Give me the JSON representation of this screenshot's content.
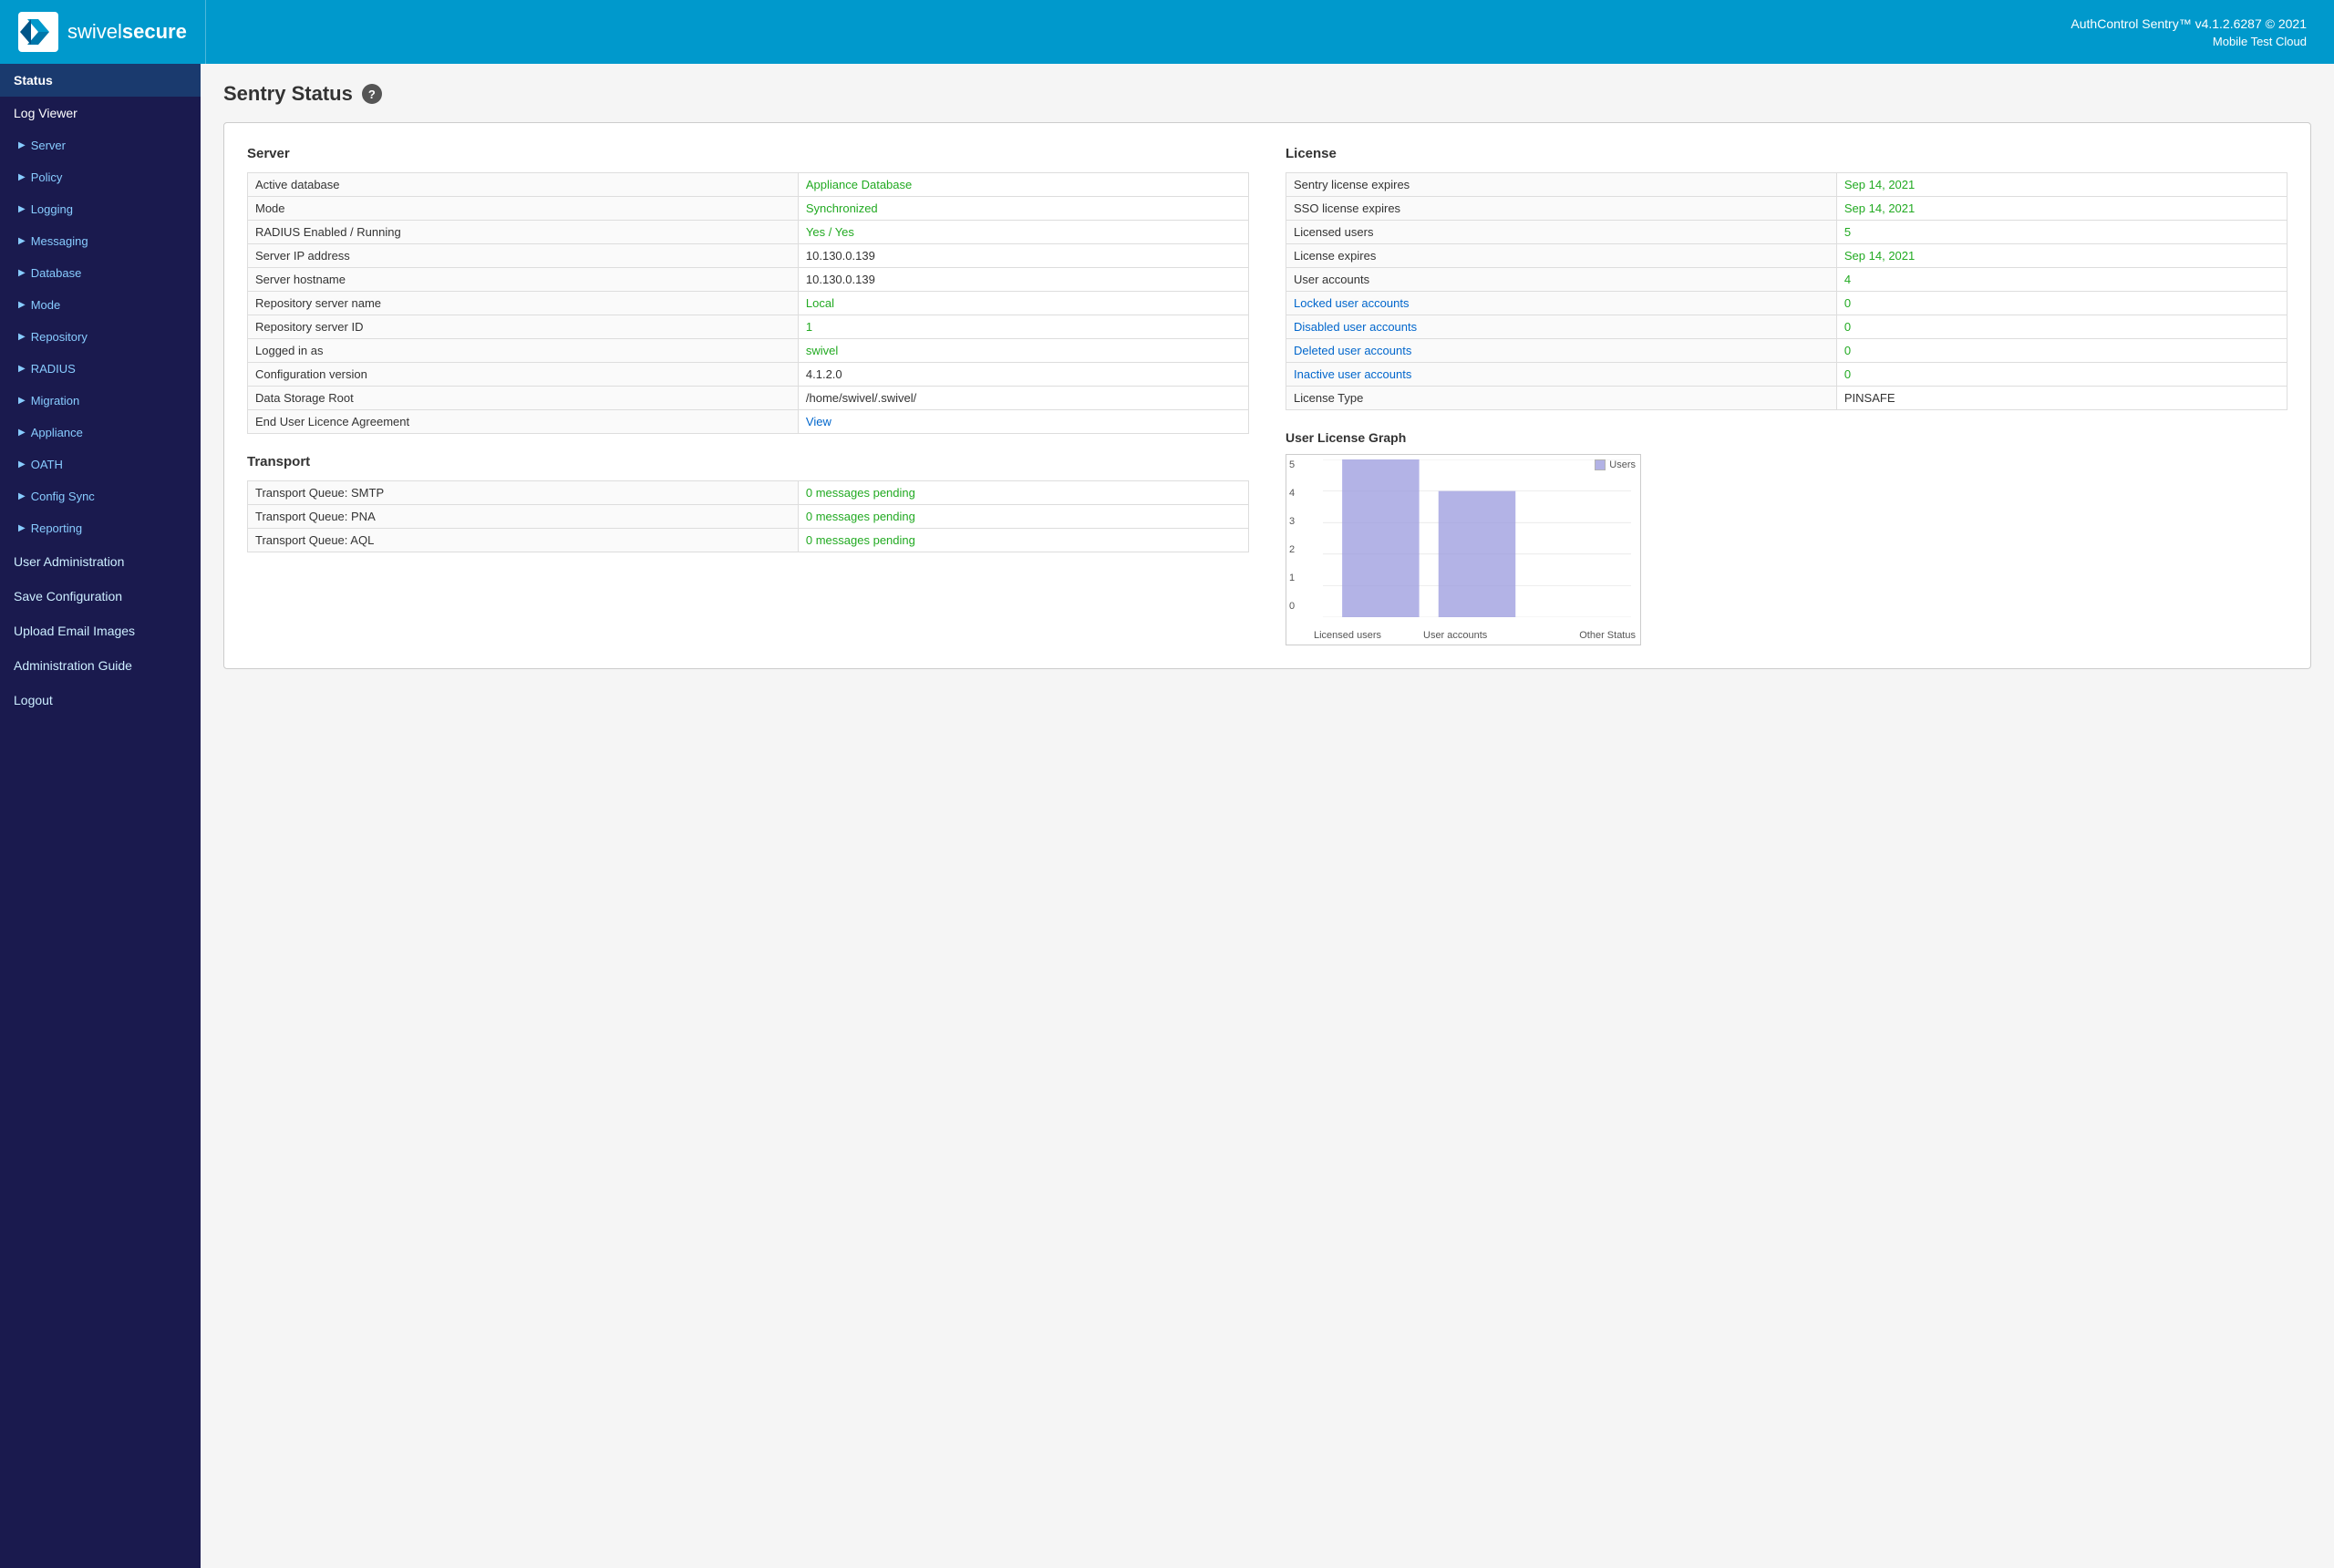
{
  "header": {
    "app_title": "AuthControl Sentry™ v4.1.2.6287 © 2021",
    "app_subtitle": "Mobile Test Cloud",
    "logo_text_normal": "swivel",
    "logo_text_bold": "secure"
  },
  "sidebar": {
    "items": [
      {
        "id": "status",
        "label": "Status",
        "level": "active",
        "chevron": false
      },
      {
        "id": "log-viewer",
        "label": "Log Viewer",
        "level": "top",
        "chevron": false
      },
      {
        "id": "server",
        "label": "Server",
        "level": "sub",
        "chevron": true
      },
      {
        "id": "policy",
        "label": "Policy",
        "level": "sub",
        "chevron": true
      },
      {
        "id": "logging",
        "label": "Logging",
        "level": "sub",
        "chevron": true
      },
      {
        "id": "messaging",
        "label": "Messaging",
        "level": "sub",
        "chevron": true
      },
      {
        "id": "database",
        "label": "Database",
        "level": "sub",
        "chevron": true
      },
      {
        "id": "mode",
        "label": "Mode",
        "level": "sub",
        "chevron": true
      },
      {
        "id": "repository",
        "label": "Repository",
        "level": "sub",
        "chevron": true
      },
      {
        "id": "radius",
        "label": "RADIUS",
        "level": "sub",
        "chevron": true
      },
      {
        "id": "migration",
        "label": "Migration",
        "level": "sub",
        "chevron": true
      },
      {
        "id": "appliance",
        "label": "Appliance",
        "level": "sub",
        "chevron": true
      },
      {
        "id": "oath",
        "label": "OATH",
        "level": "sub",
        "chevron": true
      },
      {
        "id": "config-sync",
        "label": "Config Sync",
        "level": "sub",
        "chevron": true
      },
      {
        "id": "reporting",
        "label": "Reporting",
        "level": "sub",
        "chevron": true
      },
      {
        "id": "user-admin",
        "label": "User Administration",
        "level": "plain",
        "chevron": false
      },
      {
        "id": "save-config",
        "label": "Save Configuration",
        "level": "plain",
        "chevron": false
      },
      {
        "id": "upload-email",
        "label": "Upload Email Images",
        "level": "plain",
        "chevron": false
      },
      {
        "id": "admin-guide",
        "label": "Administration Guide",
        "level": "plain",
        "chevron": false
      },
      {
        "id": "logout",
        "label": "Logout",
        "level": "plain",
        "chevron": false
      }
    ]
  },
  "page": {
    "title": "Sentry Status",
    "help_symbol": "?"
  },
  "server_section": {
    "title": "Server",
    "rows": [
      {
        "label": "Active database",
        "value": "Appliance Database",
        "style": "green"
      },
      {
        "label": "Mode",
        "value": "Synchronized",
        "style": "green"
      },
      {
        "label": "RADIUS Enabled / Running",
        "value": "Yes / Yes",
        "style": "green"
      },
      {
        "label": "Server IP address",
        "value": "10.130.0.139",
        "style": "normal"
      },
      {
        "label": "Server hostname",
        "value": "10.130.0.139",
        "style": "normal"
      },
      {
        "label": "Repository server name",
        "value": "Local",
        "style": "green"
      },
      {
        "label": "Repository server ID",
        "value": "1",
        "style": "green"
      },
      {
        "label": "Logged in as",
        "value": "swivel",
        "style": "green"
      },
      {
        "label": "Configuration version",
        "value": "4.1.2.0",
        "style": "normal"
      },
      {
        "label": "Data Storage Root",
        "value": "/home/swivel/.swivel/",
        "style": "normal"
      },
      {
        "label": "End User Licence Agreement",
        "value": "View",
        "style": "link"
      }
    ]
  },
  "transport_section": {
    "title": "Transport",
    "rows": [
      {
        "label": "Transport Queue: SMTP",
        "value": "0 messages pending",
        "style": "green"
      },
      {
        "label": "Transport Queue: PNA",
        "value": "0 messages pending",
        "style": "green"
      },
      {
        "label": "Transport Queue: AQL",
        "value": "0 messages pending",
        "style": "green"
      }
    ]
  },
  "license_section": {
    "title": "License",
    "rows": [
      {
        "label": "Sentry license expires",
        "value": "Sep 14, 2021",
        "style": "green"
      },
      {
        "label": "SSO license expires",
        "value": "Sep 14, 2021",
        "style": "green"
      },
      {
        "label": "Licensed users",
        "value": "5",
        "style": "green"
      },
      {
        "label": "License expires",
        "value": "Sep 14, 2021",
        "style": "green"
      },
      {
        "label": "User accounts",
        "value": "4",
        "style": "green"
      },
      {
        "label": "Locked user accounts",
        "value": "0",
        "style": "link"
      },
      {
        "label": "Disabled user accounts",
        "value": "0",
        "style": "link"
      },
      {
        "label": "Deleted user accounts",
        "value": "0",
        "style": "link"
      },
      {
        "label": "Inactive user accounts",
        "value": "0",
        "style": "link"
      },
      {
        "label": "License Type",
        "value": "PINSAFE",
        "style": "normal"
      }
    ]
  },
  "graph": {
    "title": "User License Graph",
    "legend_label": "Users",
    "y_max": 5,
    "bars": [
      {
        "label": "Licensed users",
        "value": 5
      },
      {
        "label": "User accounts",
        "value": 4
      },
      {
        "label": "Other Status",
        "value": 0
      }
    ],
    "y_labels": [
      "5",
      "4",
      "3",
      "2",
      "1",
      "0"
    ]
  }
}
